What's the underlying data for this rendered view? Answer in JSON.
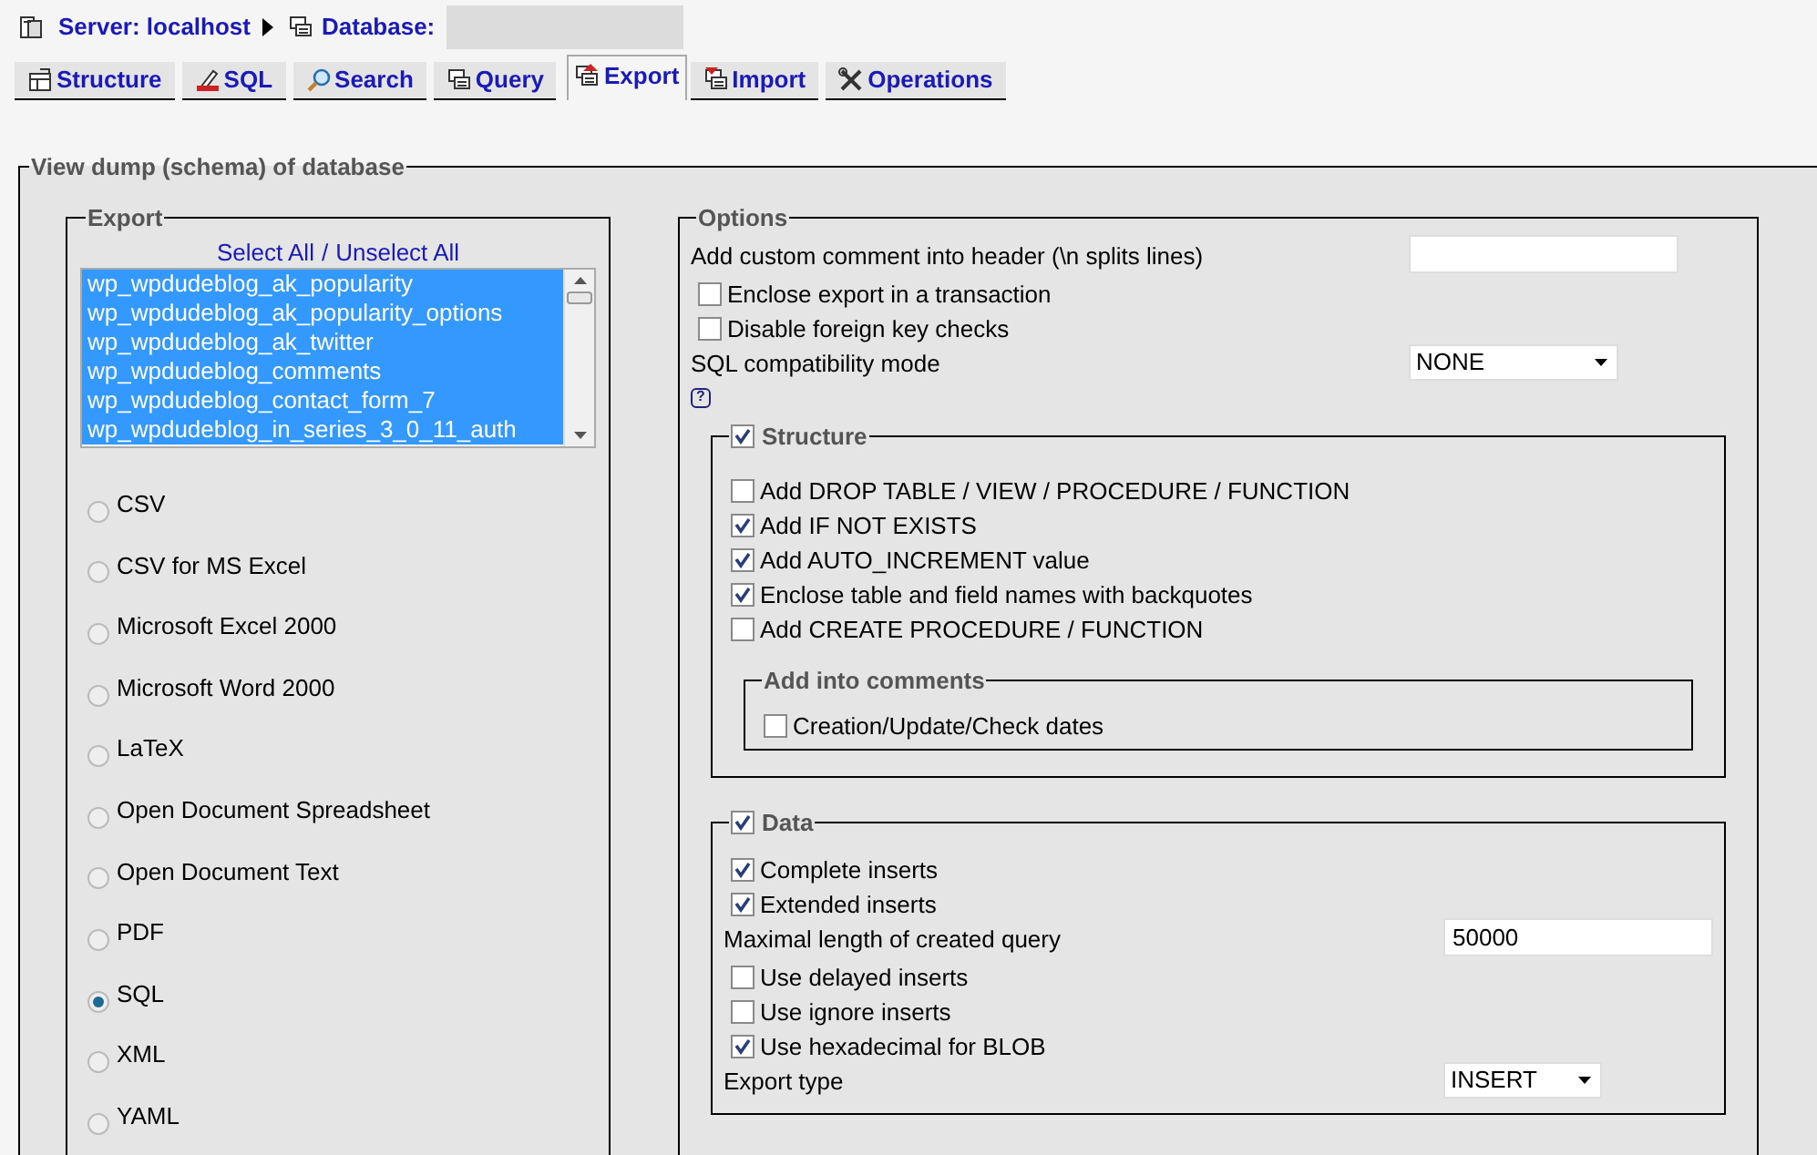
{
  "breadcrumb": {
    "server": "Server: localhost",
    "database": "Database:"
  },
  "tabs": [
    {
      "label": "Structure",
      "selected": false
    },
    {
      "label": "SQL",
      "selected": false
    },
    {
      "label": "Search",
      "selected": false
    },
    {
      "label": "Query",
      "selected": false
    },
    {
      "label": "Export",
      "selected": true
    },
    {
      "label": "Import",
      "selected": false
    },
    {
      "label": "Operations",
      "selected": false
    }
  ],
  "dump": {
    "title": "View dump (schema) of database",
    "export": {
      "title": "Export",
      "select_all": "Select All",
      "separator": "/",
      "unselect_all": "Unselect All",
      "tables": [
        {
          "name": "wp_wpdudeblog_ak_popularity",
          "selected": true
        },
        {
          "name": "wp_wpdudeblog_ak_popularity_options",
          "selected": true
        },
        {
          "name": "wp_wpdudeblog_ak_twitter",
          "selected": true
        },
        {
          "name": "wp_wpdudeblog_comments",
          "selected": true
        },
        {
          "name": "wp_wpdudeblog_contact_form_7",
          "selected": true
        },
        {
          "name": "wp_wpdudeblog_in_series_3_0_11_auth",
          "selected": true
        }
      ],
      "formats": [
        {
          "label": "CSV",
          "selected": false
        },
        {
          "label": "CSV for MS Excel",
          "selected": false
        },
        {
          "label": "Microsoft Excel 2000",
          "selected": false
        },
        {
          "label": "Microsoft Word 2000",
          "selected": false
        },
        {
          "label": "LaTeX",
          "selected": false
        },
        {
          "label": "Open Document Spreadsheet",
          "selected": false
        },
        {
          "label": "Open Document Text",
          "selected": false
        },
        {
          "label": "PDF",
          "selected": false
        },
        {
          "label": "SQL",
          "selected": true
        },
        {
          "label": "XML",
          "selected": false
        },
        {
          "label": "YAML",
          "selected": false
        }
      ]
    },
    "options": {
      "title": "Options",
      "rows": [
        {
          "kind": "input",
          "label": "Add custom comment into header (\\n splits lines)"
        },
        {
          "kind": "checkbox",
          "label": "Enclose export in a transaction",
          "checked": false
        },
        {
          "kind": "checkbox",
          "label": "Disable foreign key checks",
          "checked": false
        },
        {
          "kind": "select",
          "label": "SQL compatibility mode",
          "value": "NONE"
        },
        {
          "kind": "help",
          "label": "?"
        }
      ],
      "structure": {
        "title": "Structure",
        "checked": true,
        "rows": [
          {
            "kind": "checkbox",
            "label": "Add DROP TABLE / VIEW / PROCEDURE / FUNCTION",
            "checked": false
          },
          {
            "kind": "checkbox",
            "label": "Add IF NOT EXISTS",
            "checked": true
          },
          {
            "kind": "checkbox",
            "label": "Add AUTO_INCREMENT value",
            "checked": true
          },
          {
            "kind": "checkbox",
            "label": "Enclose table and field names with backquotes",
            "checked": true
          },
          {
            "kind": "checkbox",
            "label": "Add CREATE PROCEDURE / FUNCTION",
            "checked": false
          }
        ],
        "comments": {
          "title": "Add into comments",
          "rows": [
            {
              "kind": "checkbox",
              "label": "Creation/Update/Check dates",
              "checked": false
            }
          ]
        }
      },
      "data": {
        "title": "Data",
        "checked": true,
        "rows": [
          {
            "kind": "checkbox",
            "label": "Complete inserts",
            "checked": true
          },
          {
            "kind": "checkbox",
            "label": "Extended inserts",
            "checked": true
          },
          {
            "kind": "input",
            "label": "Maximal length of created query",
            "value": "50000"
          },
          {
            "kind": "checkbox",
            "label": "Use delayed inserts",
            "checked": false
          },
          {
            "kind": "checkbox",
            "label": "Use ignore inserts",
            "checked": false
          },
          {
            "kind": "checkbox",
            "label": "Use hexadecimal for BLOB",
            "checked": true
          },
          {
            "kind": "select",
            "label": "Export type",
            "value": "INSERT"
          }
        ]
      }
    }
  }
}
